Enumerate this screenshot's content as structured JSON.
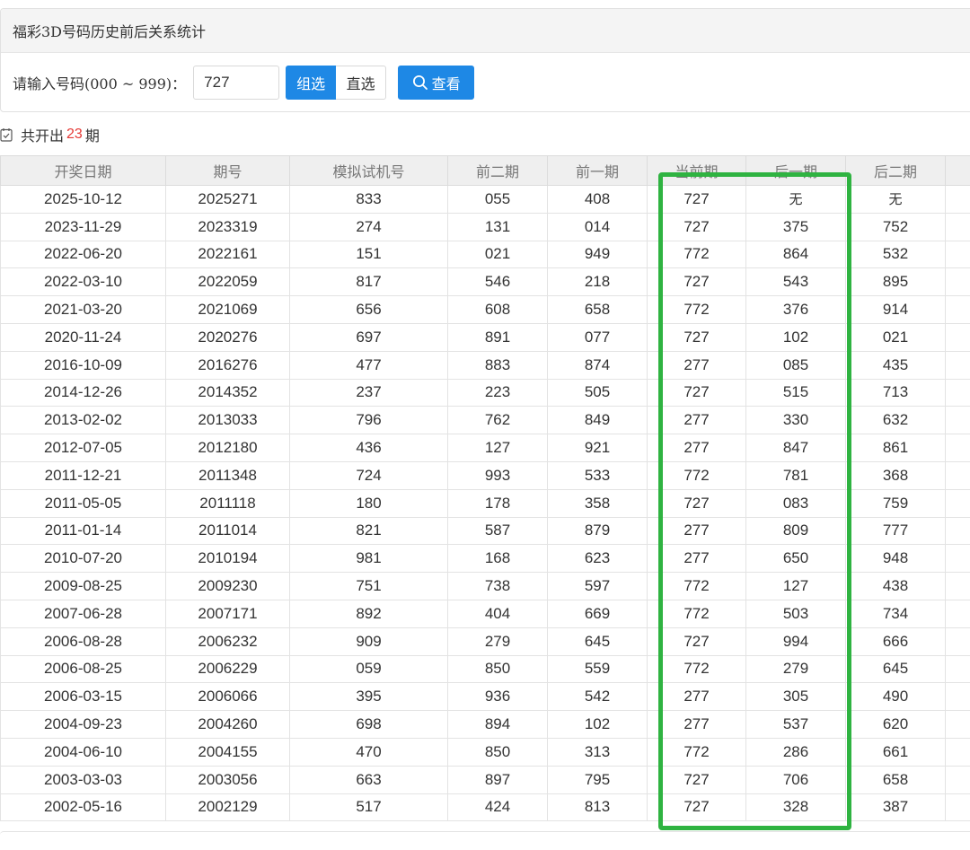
{
  "header": {
    "title": "福彩3D号码历史前后关系统计"
  },
  "query": {
    "label": "请输入号码(000 ~ 999)：",
    "value": "727",
    "mode_group": "组选",
    "mode_direct": "直选",
    "search_label": "查看"
  },
  "summary": {
    "prefix": "共开出",
    "count": "23",
    "suffix": "期"
  },
  "table": {
    "columns": [
      "开奖日期",
      "期号",
      "模拟试机号",
      "前二期",
      "前一期",
      "当前期",
      "后一期",
      "后二期",
      ""
    ],
    "rows": [
      [
        "2025-10-12",
        "2025271",
        "833",
        "055",
        "408",
        "727",
        "无",
        "无"
      ],
      [
        "2023-11-29",
        "2023319",
        "274",
        "131",
        "014",
        "727",
        "375",
        "752"
      ],
      [
        "2022-06-20",
        "2022161",
        "151",
        "021",
        "949",
        "772",
        "864",
        "532"
      ],
      [
        "2022-03-10",
        "2022059",
        "817",
        "546",
        "218",
        "727",
        "543",
        "895"
      ],
      [
        "2021-03-20",
        "2021069",
        "656",
        "608",
        "658",
        "772",
        "376",
        "914"
      ],
      [
        "2020-11-24",
        "2020276",
        "697",
        "891",
        "077",
        "727",
        "102",
        "021"
      ],
      [
        "2016-10-09",
        "2016276",
        "477",
        "883",
        "874",
        "277",
        "085",
        "435"
      ],
      [
        "2014-12-26",
        "2014352",
        "237",
        "223",
        "505",
        "727",
        "515",
        "713"
      ],
      [
        "2013-02-02",
        "2013033",
        "796",
        "762",
        "849",
        "277",
        "330",
        "632"
      ],
      [
        "2012-07-05",
        "2012180",
        "436",
        "127",
        "921",
        "277",
        "847",
        "861"
      ],
      [
        "2011-12-21",
        "2011348",
        "724",
        "993",
        "533",
        "772",
        "781",
        "368"
      ],
      [
        "2011-05-05",
        "2011118",
        "180",
        "178",
        "358",
        "727",
        "083",
        "759"
      ],
      [
        "2011-01-14",
        "2011014",
        "821",
        "587",
        "879",
        "277",
        "809",
        "777"
      ],
      [
        "2010-07-20",
        "2010194",
        "981",
        "168",
        "623",
        "277",
        "650",
        "948"
      ],
      [
        "2009-08-25",
        "2009230",
        "751",
        "738",
        "597",
        "772",
        "127",
        "438"
      ],
      [
        "2007-06-28",
        "2007171",
        "892",
        "404",
        "669",
        "772",
        "503",
        "734"
      ],
      [
        "2006-08-28",
        "2006232",
        "909",
        "279",
        "645",
        "727",
        "994",
        "666"
      ],
      [
        "2006-08-25",
        "2006229",
        "059",
        "850",
        "559",
        "772",
        "279",
        "645"
      ],
      [
        "2006-03-15",
        "2006066",
        "395",
        "936",
        "542",
        "277",
        "305",
        "490"
      ],
      [
        "2004-09-23",
        "2004260",
        "698",
        "894",
        "102",
        "277",
        "537",
        "620"
      ],
      [
        "2004-06-10",
        "2004155",
        "470",
        "850",
        "313",
        "772",
        "286",
        "661"
      ],
      [
        "2003-03-03",
        "2003056",
        "663",
        "897",
        "795",
        "727",
        "706",
        "658"
      ],
      [
        "2002-05-16",
        "2002129",
        "517",
        "424",
        "813",
        "727",
        "328",
        "387"
      ]
    ]
  },
  "colors": {
    "accent": "#1e88e5",
    "count_red": "#e53935",
    "highlight_green": "#2fb341"
  }
}
